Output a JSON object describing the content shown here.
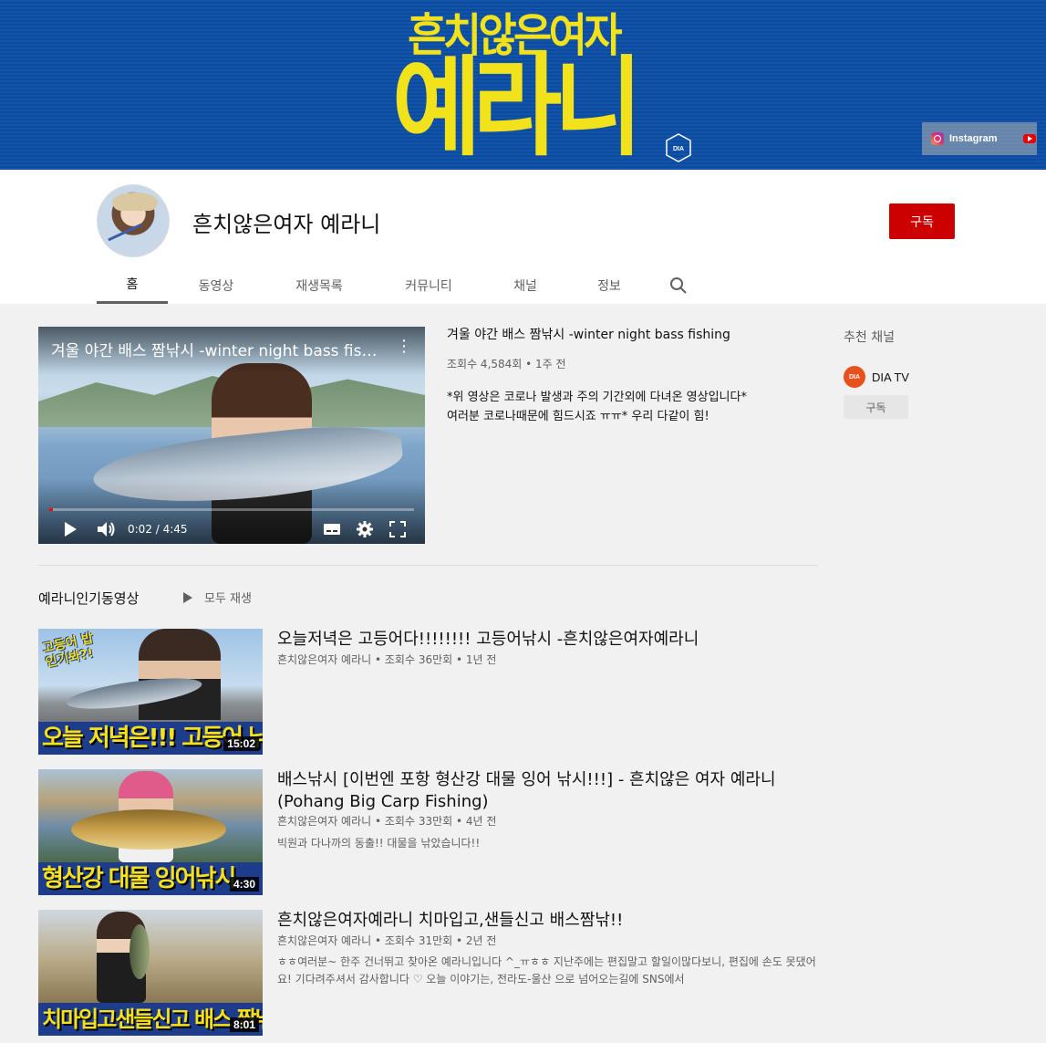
{
  "banner": {
    "line1": "흔치않은여자",
    "line2": "예라니",
    "logo_text": "DIA",
    "instagram_label": "Instagram"
  },
  "channel": {
    "name": "흔치않은여자 예라니",
    "subscribe_label": "구독",
    "tabs": [
      "홈",
      "동영상",
      "재생목록",
      "커뮤니티",
      "채널",
      "정보"
    ],
    "active_tab": "홈"
  },
  "featured": {
    "overlay_title": "겨울 야간 배스 짬낚시 -winter night bass fishing",
    "time_display": "0:02 / 4:45",
    "progress_fraction": 0.01,
    "title": "겨울 야간 배스 짬낚시 -winter night bass fishing",
    "stats": "조회수 4,584회 • 1주 전",
    "desc_line1": "*위 영상은 코로나 발생과 주의 기간외에 다녀온 영상입니다*",
    "desc_line2": "여러분 코로나때문에 힘드시죠 ㅠㅠ* 우리 다같이 힘!"
  },
  "sidebar": {
    "heading": "추천 채널",
    "channel_name": "DIA TV",
    "channel_avatar_text": "DIA",
    "subscribe_label": "구독"
  },
  "shelf": {
    "title": "예라니인기동영상",
    "play_all_label": "모두 재생"
  },
  "videos": [
    {
      "title": "오늘저녁은 고등어다!!!!!!!! 고등어낚시 -흔치않은여자예라니",
      "meta": "흔치않은여자 예라니 • 조회수 36만회 • 1년 전",
      "desc": "",
      "duration": "15:02",
      "thumb_caption": "오늘 저녁은!!! 고등어 낚시",
      "thumb_tag": "고등어 밥인기봐?!"
    },
    {
      "title": "배스낚시 [이번엔 포항 형산강 대물 잉어 낚시!!!] - 흔치않은 여자 예라니 (Pohang Big Carp Fishing)",
      "meta": "흔치않은여자 예라니 • 조회수 33만회 • 4년 전",
      "desc": "빅원과 다나까의 동출!! 대물을 낚았습니다!!",
      "duration": "4:30",
      "thumb_caption": "형산강 대물 잉어낚시"
    },
    {
      "title": "흔치않은여자예라니 치마입고,샌들신고 배스짬낚!!",
      "meta": "흔치않은여자 예라니 • 조회수 31만회 • 2년 전",
      "desc": "ㅎㅎ여러분~ 한주 건너뛰고 찾아온 예라니입니다 ^_ㅠㅎㅎ 지난주에는 편집말고 할일이많다보니, 편집에 손도 못댔어요! 기다려주셔서 감사합니다 ♡ 오늘 이야기는, 전라도-울산 으로 넘어오는길에 SNS에서",
      "duration": "8:01",
      "thumb_caption": "치마입고샌들신고 배스 짬낚!"
    }
  ],
  "colors": {
    "banner_bg": "#0b4ea6",
    "banner_text": "#f2e21c",
    "subscribe_red": "#cc0000",
    "progress_red": "#ff0000",
    "dia_orange": "#e8501c"
  }
}
